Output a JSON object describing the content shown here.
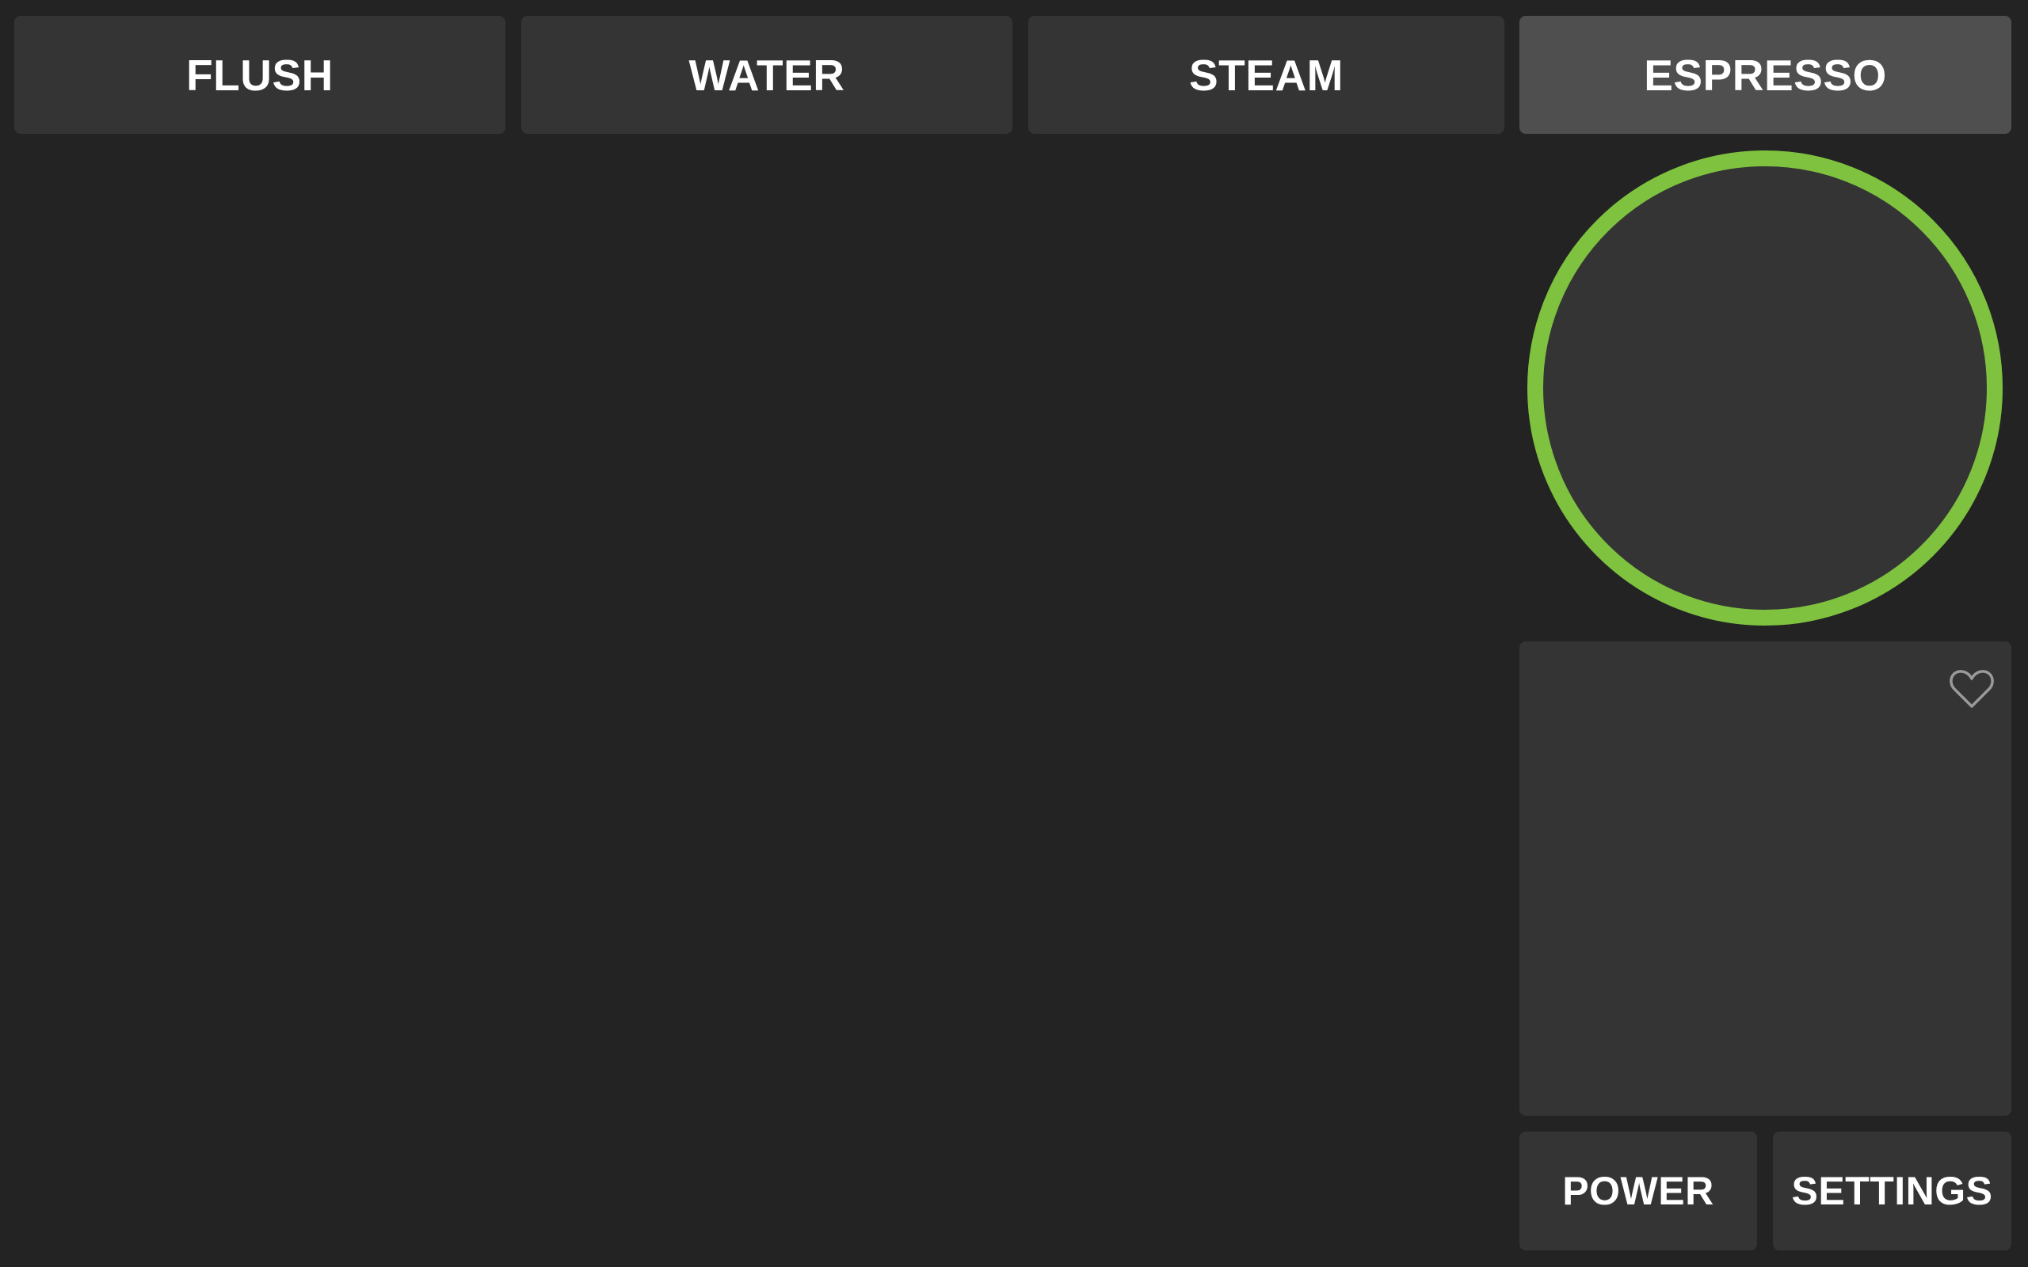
{
  "modes": {
    "flush": "FLUSH",
    "water": "WATER",
    "steam": "STEAM",
    "espresso": "ESPRESSO"
  },
  "active_mode": "espresso",
  "status_ring": {
    "color": "#7ec23f"
  },
  "favorite": {
    "icon": "heart-icon"
  },
  "footer": {
    "power": "POWER",
    "settings": "SETTINGS"
  }
}
